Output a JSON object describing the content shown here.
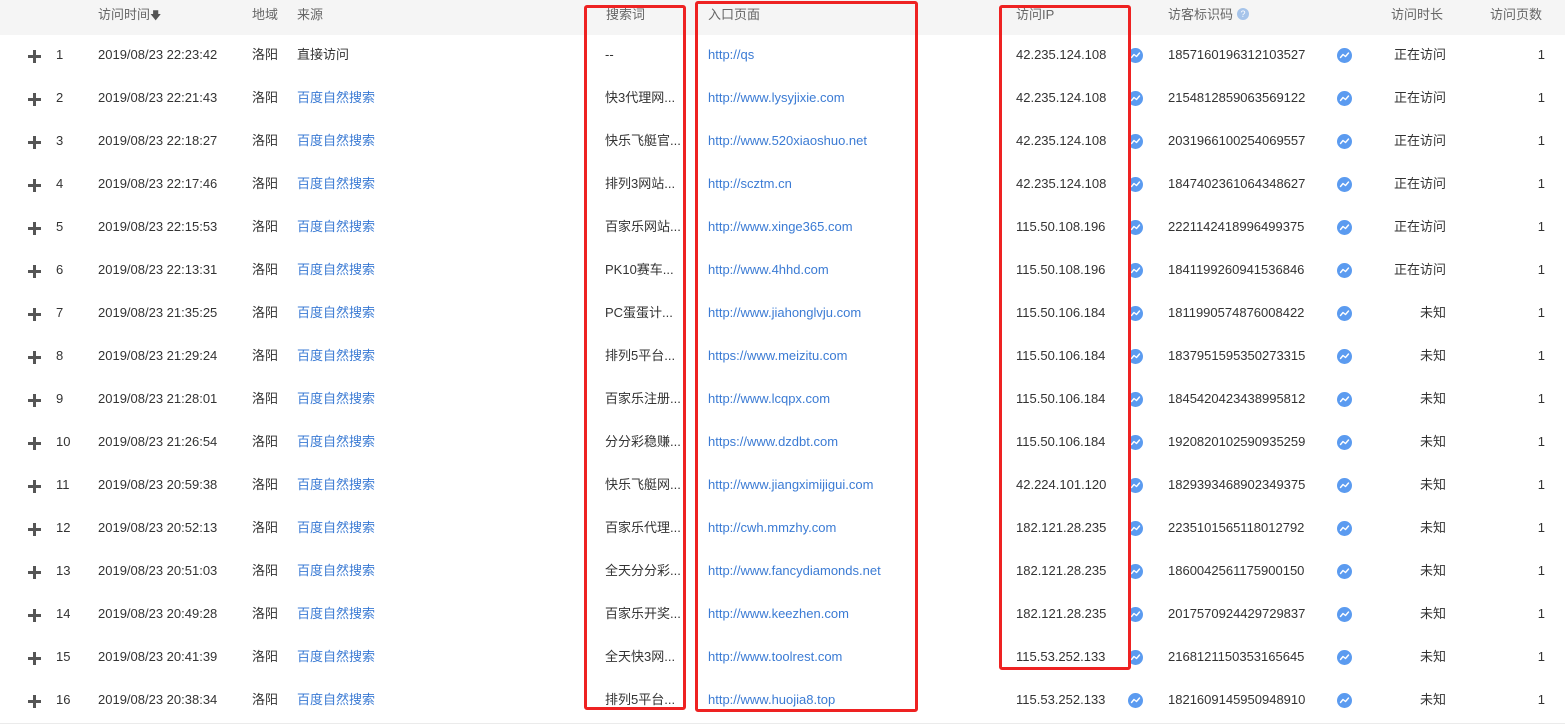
{
  "header": {
    "time": "访问时间",
    "sort_icon": "arrow-down-icon",
    "region": "地域",
    "source": "来源",
    "keyword": "搜索词",
    "entry": "入口页面",
    "ip": "访问IP",
    "visitor_id": "访客标识码",
    "help_icon": "question-icon",
    "help_glyph": "?",
    "duration": "访问时长",
    "pages": "访问页数"
  },
  "colors": {
    "link": "#3b7bd4",
    "highlight": "#ee2222",
    "trend_icon": "#5b9bf0"
  },
  "rows": [
    {
      "n": "1",
      "time": "2019/08/23 22:23:42",
      "region": "洛阳",
      "source": "直接访问",
      "keyword": "--",
      "entry": "http://qs",
      "ip": "42.235.124.108",
      "vid": "185716019631210352​7",
      "dur": "正在访问",
      "pages": "1"
    },
    {
      "n": "2",
      "time": "2019/08/23 22:21:43",
      "region": "洛阳",
      "source": "百度自然搜索",
      "keyword": "快3代理网...",
      "entry": "http://www.lysyjixie.com",
      "ip": "42.235.124.108",
      "vid": "2154812859063569122",
      "dur": "正在访问",
      "pages": "1"
    },
    {
      "n": "3",
      "time": "2019/08/23 22:18:27",
      "region": "洛阳",
      "source": "百度自然搜索",
      "keyword": "快乐飞艇官...",
      "entry": "http://www.520xiaoshuo.net",
      "ip": "42.235.124.108",
      "vid": "2031966100254069557",
      "dur": "正在访问",
      "pages": "1"
    },
    {
      "n": "4",
      "time": "2019/08/23 22:17:46",
      "region": "洛阳",
      "source": "百度自然搜索",
      "keyword": "排列3网站...",
      "entry": "http://scztm.cn",
      "ip": "42.235.124.108",
      "vid": "1847402361064348627",
      "dur": "正在访问",
      "pages": "1"
    },
    {
      "n": "5",
      "time": "2019/08/23 22:15:53",
      "region": "洛阳",
      "source": "百度自然搜索",
      "keyword": "百家乐网站...",
      "entry": "http://www.xinge365.com",
      "ip": "115.50.108.196",
      "vid": "2221142418996499375",
      "dur": "正在访问",
      "pages": "1"
    },
    {
      "n": "6",
      "time": "2019/08/23 22:13:31",
      "region": "洛阳",
      "source": "百度自然搜索",
      "keyword": "PK10赛车...",
      "entry": "http://www.4hhd.com",
      "ip": "115.50.108.196",
      "vid": "1841199260941536846",
      "dur": "正在访问",
      "pages": "1"
    },
    {
      "n": "7",
      "time": "2019/08/23 21:35:25",
      "region": "洛阳",
      "source": "百度自然搜索",
      "keyword": "PC蛋蛋计...",
      "entry": "http://www.jiahonglvju.com",
      "ip": "115.50.106.184",
      "vid": "1811990574876008422",
      "dur": "未知",
      "pages": "1"
    },
    {
      "n": "8",
      "time": "2019/08/23 21:29:24",
      "region": "洛阳",
      "source": "百度自然搜索",
      "keyword": "排列5平台...",
      "entry": "https://www.meizitu.com",
      "ip": "115.50.106.184",
      "vid": "1837951595350273315",
      "dur": "未知",
      "pages": "1"
    },
    {
      "n": "9",
      "time": "2019/08/23 21:28:01",
      "region": "洛阳",
      "source": "百度自然搜索",
      "keyword": "百家乐注册...",
      "entry": "http://www.lcqpx.com",
      "ip": "115.50.106.184",
      "vid": "1845420423438995812",
      "dur": "未知",
      "pages": "1"
    },
    {
      "n": "10",
      "time": "2019/08/23 21:26:54",
      "region": "洛阳",
      "source": "百度自然搜索",
      "keyword": "分分彩稳赚...",
      "entry": "https://www.dzdbt.com",
      "ip": "115.50.106.184",
      "vid": "1920820102590935259",
      "dur": "未知",
      "pages": "1"
    },
    {
      "n": "11",
      "time": "2019/08/23 20:59:38",
      "region": "洛阳",
      "source": "百度自然搜索",
      "keyword": "快乐飞艇网...",
      "entry": "http://www.jiangximijigui.com",
      "ip": "42.224.101.120",
      "vid": "1829393468902349375",
      "dur": "未知",
      "pages": "1"
    },
    {
      "n": "12",
      "time": "2019/08/23 20:52:13",
      "region": "洛阳",
      "source": "百度自然搜索",
      "keyword": "百家乐代理...",
      "entry": "http://cwh.mmzhy.com",
      "ip": "182.121.28.235",
      "vid": "2235101565118012792",
      "dur": "未知",
      "pages": "1"
    },
    {
      "n": "13",
      "time": "2019/08/23 20:51:03",
      "region": "洛阳",
      "source": "百度自然搜索",
      "keyword": "全天分分彩...",
      "entry": "http://www.fancydiamonds.net",
      "ip": "182.121.28.235",
      "vid": "1860042561175900150",
      "dur": "未知",
      "pages": "1"
    },
    {
      "n": "14",
      "time": "2019/08/23 20:49:28",
      "region": "洛阳",
      "source": "百度自然搜索",
      "keyword": "百家乐开奖...",
      "entry": "http://www.keezhen.com",
      "ip": "182.121.28.235",
      "vid": "2017570924429729837",
      "dur": "未知",
      "pages": "1"
    },
    {
      "n": "15",
      "time": "2019/08/23 20:41:39",
      "region": "洛阳",
      "source": "百度自然搜索",
      "keyword": "全天快3网...",
      "entry": "http://www.toolrest.com",
      "ip": "115.53.252.133",
      "vid": "2168121150353165645",
      "dur": "未知",
      "pages": "1"
    },
    {
      "n": "16",
      "time": "2019/08/23 20:38:34",
      "region": "洛阳",
      "source": "百度自然搜索",
      "keyword": "排列5平台...",
      "entry": "http://www.huojia8.top",
      "ip": "115.53.252.133",
      "vid": "1821609145950948910",
      "dur": "未知",
      "pages": "1"
    }
  ]
}
